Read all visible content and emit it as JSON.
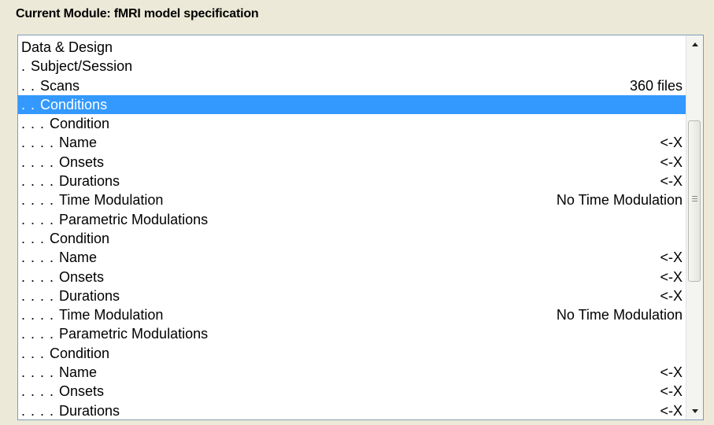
{
  "module_title": "Current Module: fMRI model specification",
  "rows": [
    {
      "dots": "",
      "label": "Data & Design",
      "value": "",
      "selected": false
    },
    {
      "dots": ". ",
      "label": "Subject/Session",
      "value": "",
      "selected": false
    },
    {
      "dots": ". . ",
      "label": "Scans",
      "value": "360 files",
      "selected": false
    },
    {
      "dots": ". . ",
      "label": "Conditions",
      "value": "",
      "selected": true
    },
    {
      "dots": ". . . ",
      "label": "Condition",
      "value": "",
      "selected": false
    },
    {
      "dots": ". . . . ",
      "label": "Name",
      "value": "<-X",
      "selected": false
    },
    {
      "dots": ". . . . ",
      "label": "Onsets",
      "value": "<-X",
      "selected": false
    },
    {
      "dots": ". . . . ",
      "label": "Durations",
      "value": "<-X",
      "selected": false
    },
    {
      "dots": ". . . . ",
      "label": "Time Modulation",
      "value": "No Time Modulation",
      "selected": false
    },
    {
      "dots": ". . . . ",
      "label": "Parametric Modulations",
      "value": "",
      "selected": false
    },
    {
      "dots": ". . . ",
      "label": "Condition",
      "value": "",
      "selected": false
    },
    {
      "dots": ". . . . ",
      "label": "Name",
      "value": "<-X",
      "selected": false
    },
    {
      "dots": ". . . . ",
      "label": "Onsets",
      "value": "<-X",
      "selected": false
    },
    {
      "dots": ". . . . ",
      "label": "Durations",
      "value": "<-X",
      "selected": false
    },
    {
      "dots": ". . . . ",
      "label": "Time Modulation",
      "value": "No Time Modulation",
      "selected": false
    },
    {
      "dots": ". . . . ",
      "label": "Parametric Modulations",
      "value": "",
      "selected": false
    },
    {
      "dots": ". . . ",
      "label": "Condition",
      "value": "",
      "selected": false
    },
    {
      "dots": ". . . . ",
      "label": "Name",
      "value": "<-X",
      "selected": false
    },
    {
      "dots": ". . . . ",
      "label": "Onsets",
      "value": "<-X",
      "selected": false
    },
    {
      "dots": ". . . . ",
      "label": "Durations",
      "value": "<-X",
      "selected": false
    }
  ],
  "colors": {
    "selection": "#3399ff",
    "background": "#ece9d8"
  }
}
